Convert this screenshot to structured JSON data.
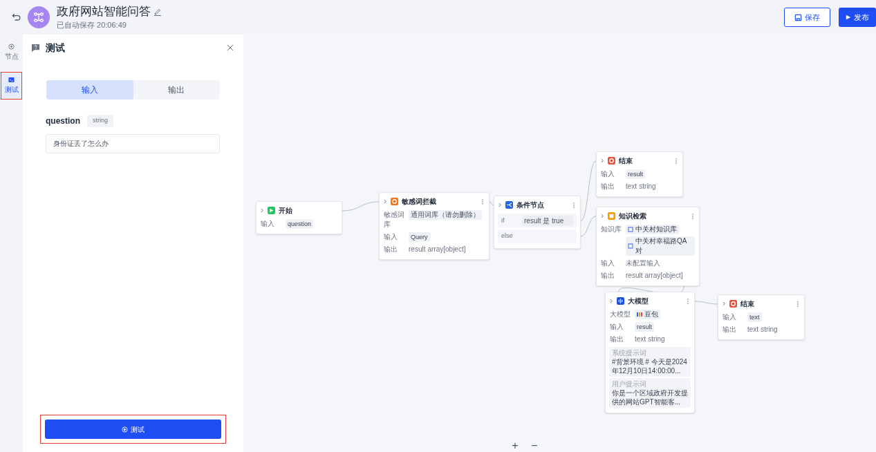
{
  "header": {
    "title": "政府网站智能问答",
    "autosave": "已自动保存 20:06:49"
  },
  "actions": [
    {
      "label": "保存",
      "kind": "outline"
    },
    {
      "label": "发布",
      "kind": "primary"
    }
  ],
  "sidebar": {
    "items": [
      {
        "label": "节点",
        "kind": "nodes",
        "selected": false,
        "highlighted": false
      },
      {
        "label": "测试",
        "kind": "test",
        "selected": true,
        "highlighted": true
      }
    ]
  },
  "panel": {
    "title": "测试",
    "tabs": [
      {
        "label": "输入",
        "selected": true
      },
      {
        "label": "输出",
        "selected": false
      }
    ],
    "param": {
      "name": "question",
      "type": "string"
    },
    "input": {
      "value": "身份证丢了怎么办"
    },
    "run_button": {
      "label": "测试",
      "highlighted": true
    }
  },
  "canvas": {
    "nodes": [
      {
        "kind": "start",
        "title": "开始",
        "color": "#22c55e",
        "menu": false,
        "rows": [
          {
            "kind": "field",
            "label": "输入",
            "values": [
              {
                "text": "question",
                "kind": "chip"
              }
            ]
          }
        ]
      },
      {
        "kind": "filter",
        "title": "敏感词拦截",
        "color": "#f97316",
        "menu": true,
        "rows": [
          {
            "kind": "field",
            "label": "敏感词库",
            "values": [
              {
                "text": "通用词库（请勿删除）",
                "kind": "tag"
              }
            ]
          },
          {
            "kind": "field",
            "label": "输入",
            "values": [
              {
                "text": "Query",
                "kind": "chip"
              }
            ]
          },
          {
            "kind": "field",
            "label": "输出",
            "values": [
              {
                "text": "result",
                "kind": "plain"
              },
              {
                "text": "array[object]",
                "kind": "plain"
              }
            ]
          }
        ]
      },
      {
        "kind": "condition",
        "title": "条件节点",
        "color": "#2563eb",
        "menu": true,
        "rows": [
          {
            "kind": "branch",
            "label": "if",
            "expr": "result 是 true"
          },
          {
            "kind": "branch",
            "label": "else"
          }
        ]
      },
      {
        "kind": "end",
        "title": "结束",
        "color": "#e5533d",
        "menu": true,
        "rows": [
          {
            "kind": "field",
            "label": "输入",
            "values": [
              {
                "text": "result",
                "kind": "chip"
              }
            ]
          },
          {
            "kind": "field",
            "label": "输出",
            "values": [
              {
                "text": "text",
                "kind": "plain"
              },
              {
                "text": "string",
                "kind": "plain"
              }
            ]
          }
        ]
      },
      {
        "kind": "knowledge",
        "title": "知识检索",
        "color": "#f59e0b",
        "menu": true,
        "rows": [
          {
            "kind": "field",
            "label": "知识库",
            "values": [
              {
                "text": "中关村知识库",
                "kind": "kb"
              },
              {
                "text": "中关村幸福路QA对",
                "kind": "kb"
              }
            ]
          },
          {
            "kind": "field",
            "label": "输入",
            "values": [
              {
                "text": "未配置输入",
                "kind": "plain"
              }
            ]
          },
          {
            "kind": "field",
            "label": "输出",
            "values": [
              {
                "text": "result",
                "kind": "plain"
              },
              {
                "text": "array[object]",
                "kind": "plain"
              }
            ]
          }
        ]
      },
      {
        "kind": "llm",
        "title": "大模型",
        "color": "#1d4ed8",
        "menu": true,
        "rows": [
          {
            "kind": "field",
            "label": "大模型",
            "values": [
              {
                "text": "豆包",
                "kind": "model"
              }
            ]
          },
          {
            "kind": "field",
            "label": "输入",
            "values": [
              {
                "text": "result",
                "kind": "chip"
              }
            ]
          },
          {
            "kind": "field",
            "label": "输出",
            "values": [
              {
                "text": "text",
                "kind": "plain"
              },
              {
                "text": "string",
                "kind": "plain"
              }
            ]
          },
          {
            "kind": "prompt",
            "label": "系统提示词",
            "text": "#背景环境 # 今天是2024年12月10日14:00:00..."
          },
          {
            "kind": "prompt",
            "label": "用户提示词",
            "text": "你是一个区域政府开发提供的网站GPT智能客..."
          }
        ]
      },
      {
        "kind": "end",
        "title": "结束",
        "color": "#e5533d",
        "menu": true,
        "rows": [
          {
            "kind": "field",
            "label": "输入",
            "values": [
              {
                "text": "text",
                "kind": "chip"
              }
            ]
          },
          {
            "kind": "field",
            "label": "输出",
            "values": [
              {
                "text": "text",
                "kind": "plain"
              },
              {
                "text": "string",
                "kind": "plain"
              }
            ]
          }
        ]
      }
    ],
    "zoom_controls": [
      "+",
      "−"
    ]
  }
}
